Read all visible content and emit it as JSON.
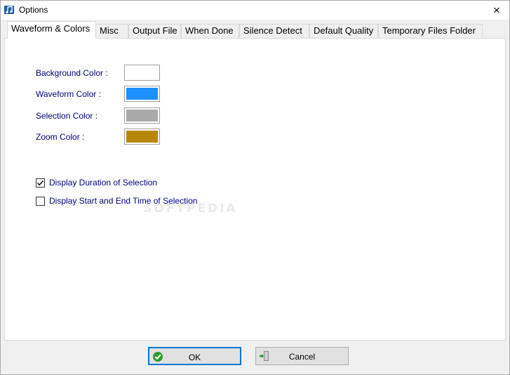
{
  "window": {
    "title": "Options",
    "close_symbol": "×"
  },
  "tabs": [
    {
      "label": "Waveform & Colors",
      "active": true
    },
    {
      "label": "Misc",
      "active": false
    },
    {
      "label": "Output File",
      "active": false
    },
    {
      "label": "When Done",
      "active": false
    },
    {
      "label": "Silence Detect",
      "active": false
    },
    {
      "label": "Default Quality",
      "active": false
    },
    {
      "label": "Temporary Files Folder",
      "active": false
    }
  ],
  "colors": [
    {
      "label": "Background Color :",
      "value": "#ffffff"
    },
    {
      "label": "Waveform Color :",
      "value": "#1e90ff"
    },
    {
      "label": "Selection Color :",
      "value": "#a9a9a9"
    },
    {
      "label": "Zoom Color :",
      "value": "#b8860b"
    }
  ],
  "options": [
    {
      "label": "Display Duration of Selection",
      "checked": true
    },
    {
      "label": "Display Start and End Time of Selection",
      "checked": false
    }
  ],
  "watermark": "SOFTPEDIA",
  "buttons": {
    "ok_label": "OK",
    "cancel_label": "Cancel"
  },
  "icons": {
    "app": "music-note-icon",
    "ok": "green-check-icon",
    "cancel": "exit-door-icon"
  }
}
